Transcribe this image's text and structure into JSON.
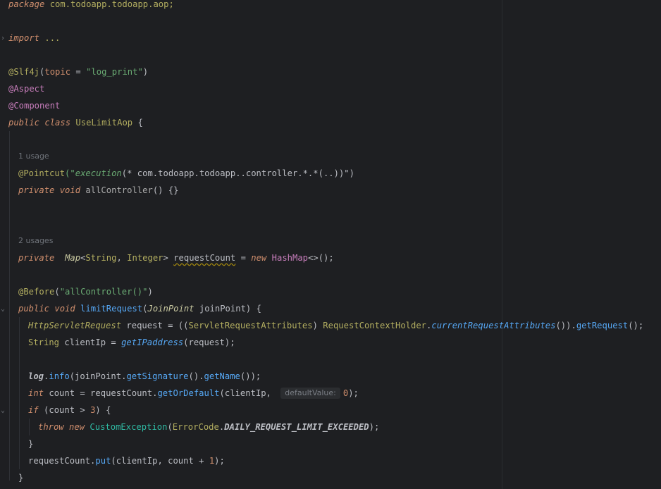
{
  "editor": {
    "lines": {
      "l01": {
        "kw": "package",
        "rest": " com.todoapp.todoapp.aop;"
      },
      "l03": {
        "kw": "import",
        "rest": " ..."
      },
      "l05": {
        "ann": "@Slf4j",
        "p1": "(",
        "attr": "topic",
        "p2": " = ",
        "str": "\"log_print\"",
        "p3": ")"
      },
      "l06": {
        "ann": "@Aspect"
      },
      "l07": {
        "ann": "@Component"
      },
      "l08": {
        "kw1": "public",
        "kw2": "class",
        "name": "UseLimitAop",
        "rest": " {"
      },
      "l10": {
        "usage": "1 usage"
      },
      "l11": {
        "ann": "@Pointcut",
        "p1": "(\"",
        "fn": "execution",
        "rest": "(* com.todoapp.todoapp..controller.*.*(..))\"",
        "p2": ")"
      },
      "l12": {
        "kw1": "private",
        "kw2": "void",
        "name": "allController",
        "rest": "() {}"
      },
      "l15": {
        "usage": "2 usages"
      },
      "l16": {
        "kw": "private",
        "t1": "Map",
        "p1": "<",
        "t2": "String",
        "c": ", ",
        "t3": "Integer",
        "p2": "> ",
        "var": "requestCount",
        "eq": " = ",
        "new": "new",
        "t4": "HashMap",
        "rest": "<>();"
      },
      "l18": {
        "ann": "@Before",
        "p1": "(",
        "str": "\"allController()\"",
        "p2": ")"
      },
      "l19": {
        "kw1": "public",
        "kw2": "void",
        "name": "limitRequest",
        "p1": "(",
        "t": "JoinPoint",
        "rest": " joinPoint) {"
      },
      "l20": {
        "t1": "HttpServletRequest",
        "r1": " request = ((",
        "t2": "ServletRequestAttributes",
        "r2": ") ",
        "t3": "RequestContextHolder",
        "dot": ".",
        "m1": "currentRequestAttributes",
        "r3": "()).",
        "m2": "getRequest",
        "r4": "();"
      },
      "l21": {
        "t": "String",
        "r1": " clientIp = ",
        "m": "getIPaddress",
        "r2": "(request);"
      },
      "l23": {
        "log": "log",
        "dot": ".",
        "m1": "info",
        "r1": "(joinPoint.",
        "m2": "getSignature",
        "r2": "().",
        "m3": "getName",
        "r3": "());"
      },
      "l24": {
        "kw": "int",
        "r1": " count = requestCount.",
        "m": "getOrDefault",
        "r2": "(clientIp, ",
        "hint": "defaultValue:",
        "num": "0",
        "r3": ");"
      },
      "l25": {
        "kw": "if",
        "r1": " (count > ",
        "num": "3",
        "r2": ") {"
      },
      "l26": {
        "kw1": "throw",
        "kw2": "new",
        "t": "CustomException",
        "r1": "(",
        "t2": "ErrorCode",
        "dot": ".",
        "const": "DAILY_REQUEST_LIMIT_EXCEEDED",
        "r2": ");"
      },
      "l27": {
        "text": "}"
      },
      "l28": {
        "r1": "requestCount.",
        "m": "put",
        "r2": "(clientIp, count + ",
        "num": "1",
        "r3": ");"
      },
      "l29": {
        "text": "}"
      }
    },
    "colors": {
      "background": "#1e1f22",
      "keyword": "#cf8e6d",
      "annotation": "#b3ae60",
      "string": "#6aab73",
      "method": "#56a8f5",
      "number": "#2aacb8",
      "constant": "#c77dbb"
    }
  }
}
